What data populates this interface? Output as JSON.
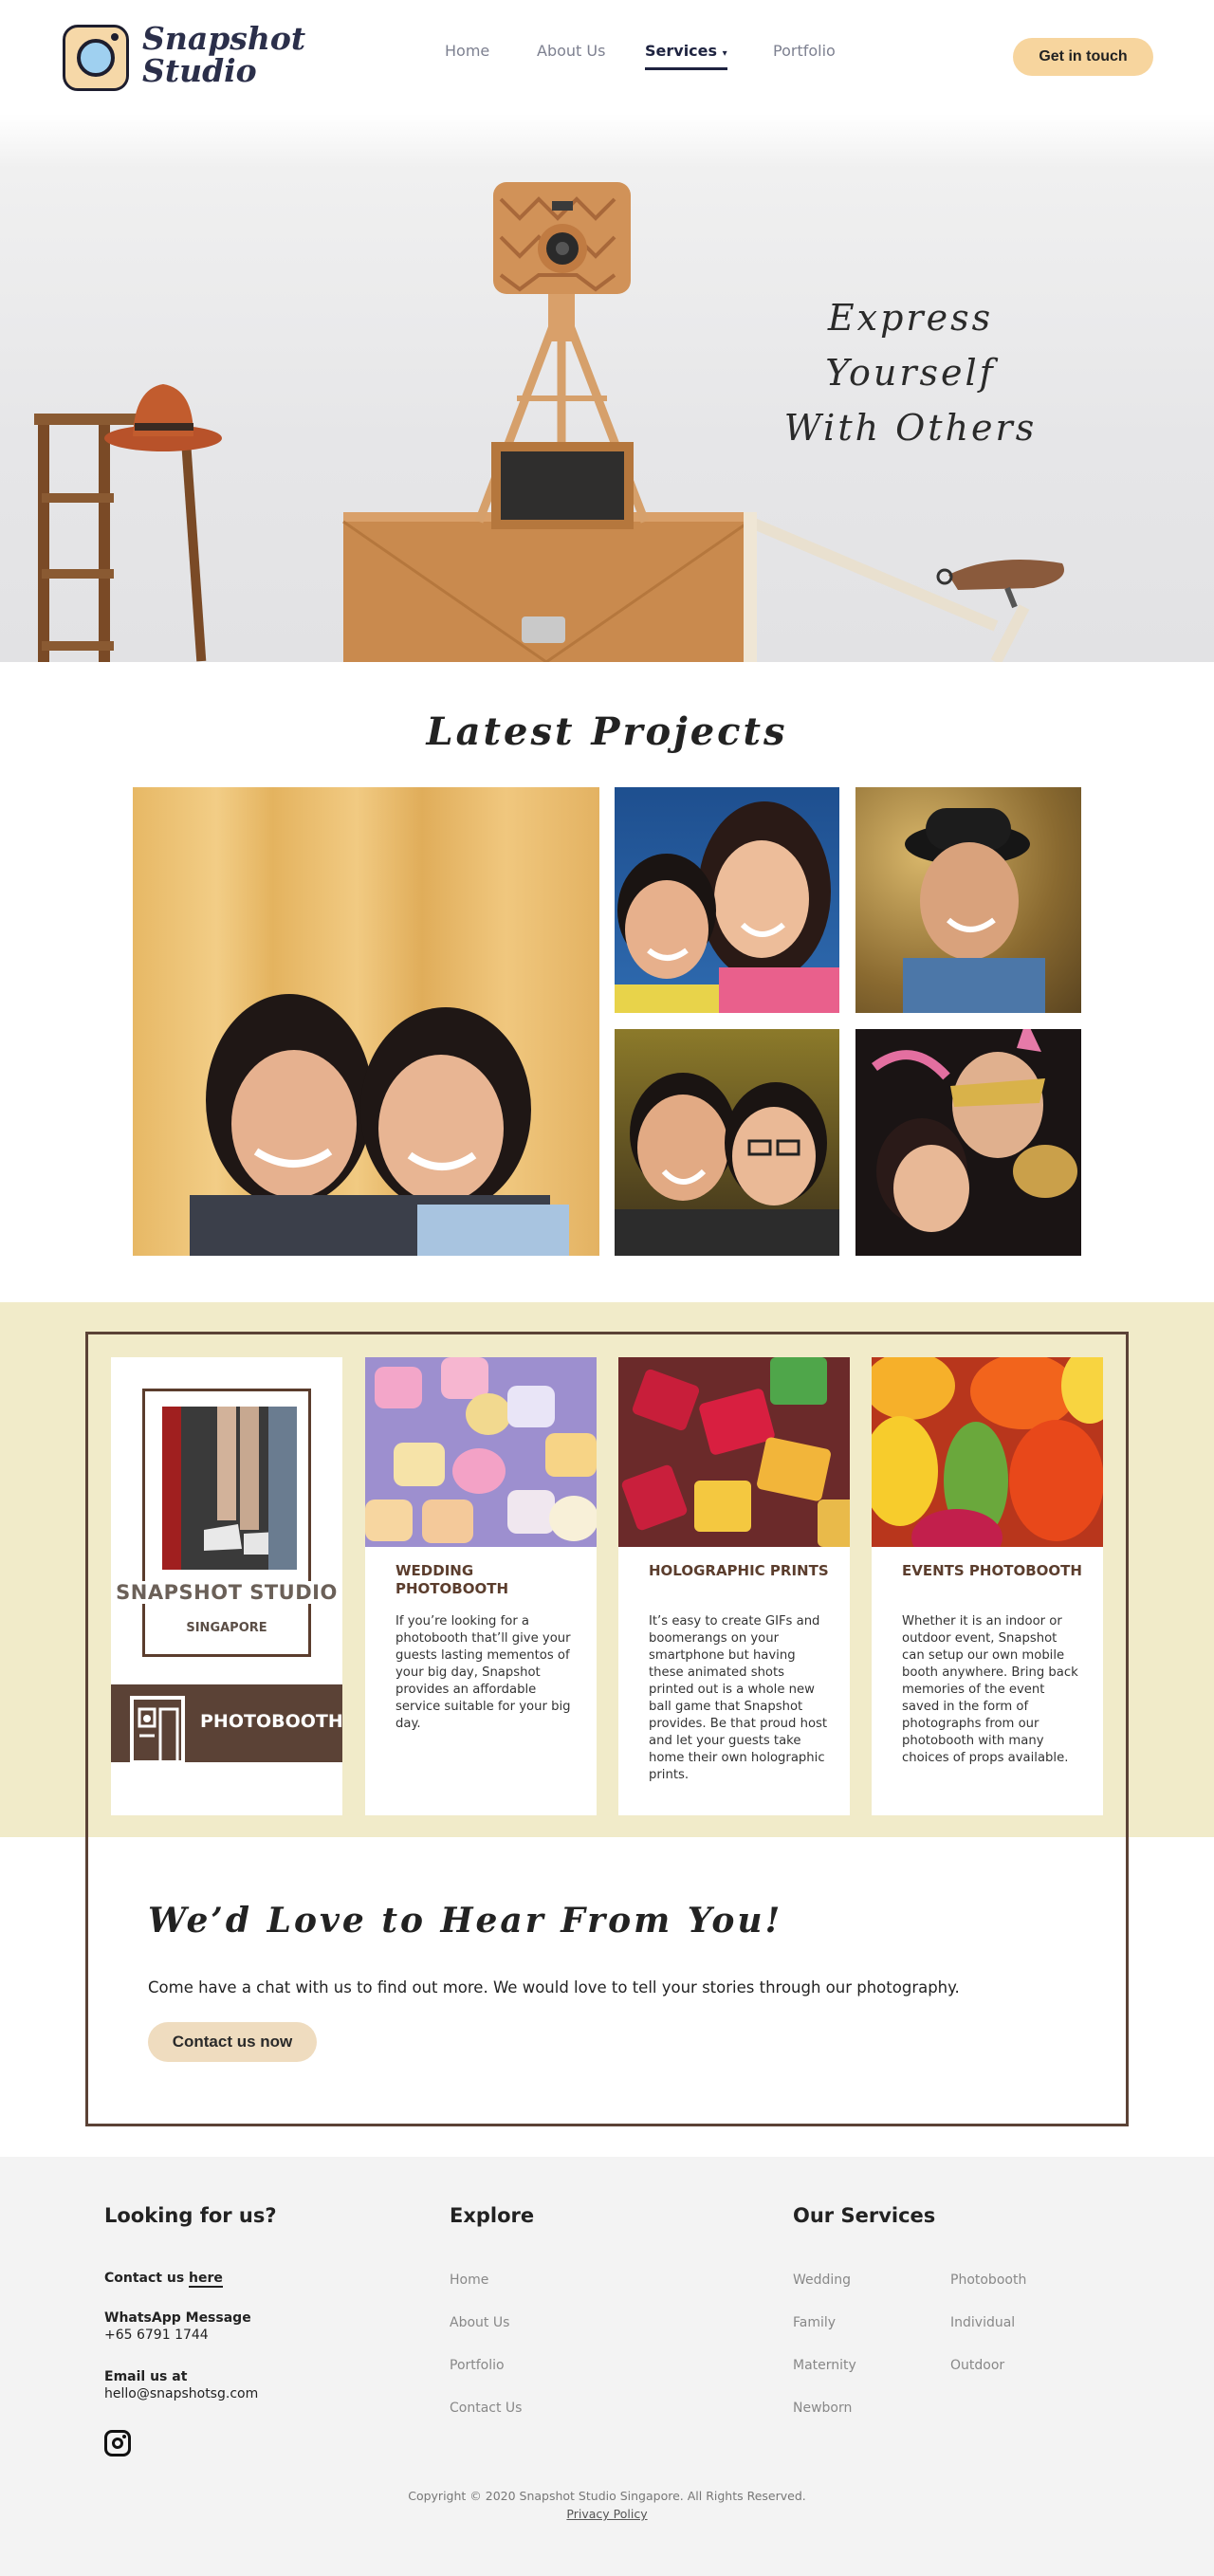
{
  "brand": {
    "line1": "Snapshot",
    "line2": "Studio"
  },
  "nav": {
    "items": [
      {
        "label": "Home"
      },
      {
        "label": "About Us"
      },
      {
        "label": "Services"
      },
      {
        "label": "Portfolio"
      }
    ],
    "active": "Services",
    "cta": "Get in touch"
  },
  "hero": {
    "line1": "Express Yourself",
    "line2": "With Others"
  },
  "projects": {
    "title": "Latest Projects"
  },
  "brand_card": {
    "name": "SNAPSHOT STUDIO",
    "location": "SINGAPORE",
    "badge": "PHOTOBOOTH"
  },
  "services": [
    {
      "title": "WEDDING PHOTOBOOTH",
      "body": "If you’re looking for a photobooth that’ll give your guests lasting mementos of your big day, Snapshot provides an affordable service suitable for your big day."
    },
    {
      "title": "HOLOGRAPHIC PRINTS",
      "body": "It’s easy to create GIFs and boomerangs on your smartphone but having these animated shots printed out is a whole new ball game that Snapshot provides. Be that proud host and let your guests take home their own holographic prints."
    },
    {
      "title": "EVENTS PHOTOBOOTH",
      "body": "Whether it is an indoor or outdoor event, Snapshot can setup our own mobile booth anywhere. Bring back memories of the event saved in the form of photographs from our photobooth with many choices of props available."
    }
  ],
  "contact": {
    "title": "We’d Love to Hear From You!",
    "text": "Come have a chat with us to find out more. We would love to tell your stories through our photography.",
    "button": "Contact us now"
  },
  "footer": {
    "col1": {
      "heading": "Looking for us?",
      "contact_prefix": "Contact us",
      "contact_link": "here",
      "whatsapp_label": "WhatsApp Message",
      "whatsapp_number": "+65 6791 1744",
      "email_label": "Email us at",
      "email": "hello@snapshotsg.com",
      "social_icon": "instagram-icon"
    },
    "col2": {
      "heading": "Explore",
      "links": [
        "Home",
        "About Us",
        "Portfolio",
        "Contact Us"
      ]
    },
    "col3": {
      "heading": "Our Services",
      "links_a": [
        "Wedding",
        "Family",
        "Maternity",
        "Newborn"
      ],
      "links_b": [
        "Photobooth",
        "Individual",
        "Outdoor"
      ]
    },
    "copyright": "Copyright © 2020 Snapshot Studio Singapore. All Rights Reserved.",
    "privacy": "Privacy Policy"
  },
  "colors": {
    "accent": "#f7d59e",
    "brown": "#5b4236",
    "cream": "#f1ebc9",
    "footer": "#f3f3f3"
  }
}
